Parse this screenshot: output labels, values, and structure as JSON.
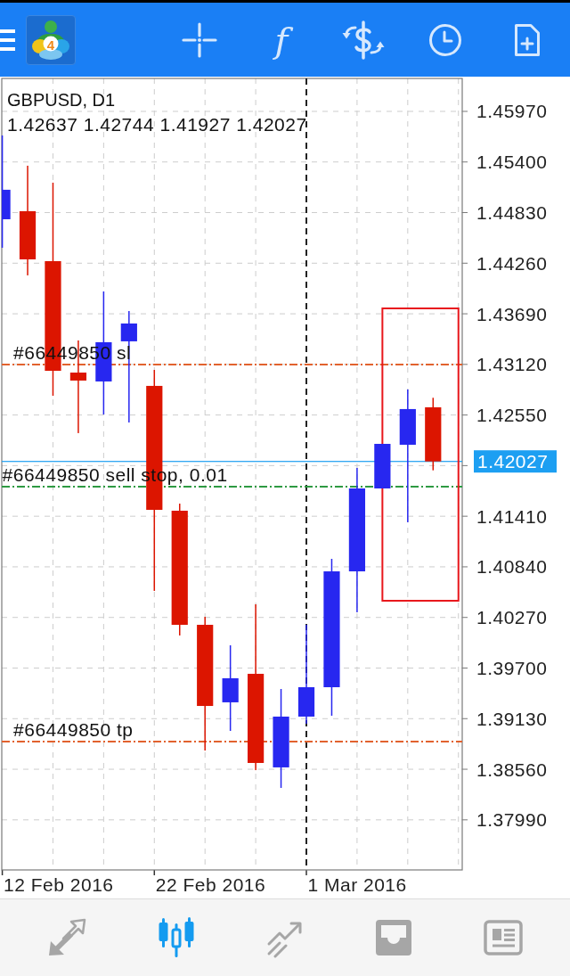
{
  "toolbar": {
    "logo": {
      "text": "4"
    },
    "items": [
      {
        "kind": "crosshair"
      },
      {
        "kind": "function",
        "text": "f"
      },
      {
        "kind": "exchange"
      },
      {
        "kind": "clock"
      },
      {
        "kind": "new_document"
      }
    ]
  },
  "chart": {
    "title": "GBPUSD, D1",
    "ohlc": "1.42637 1.42744 1.41927 1.42027",
    "order_lines": [
      {
        "label": "#66449850 sl",
        "color": "#e2622e"
      },
      {
        "label": "#66449850 sell stop, 0.01",
        "color": "#2e9a42"
      },
      {
        "label": "#66449850 tp",
        "color": "#e2622e"
      }
    ],
    "price_axis": [
      "1.45970",
      "1.45400",
      "1.44830",
      "1.44260",
      "1.43690",
      "1.43120",
      "1.42550",
      "1.41410",
      "1.40840",
      "1.40270",
      "1.39700",
      "1.39130",
      "1.38560",
      "1.37990"
    ],
    "price_tag": "1.42027",
    "date_axis": [
      "12 Feb 2016",
      "22 Feb 2016",
      "1 Mar 2016"
    ]
  },
  "bottom_nav": [
    {
      "kind": "quotes",
      "selected": false
    },
    {
      "kind": "chart",
      "selected": true
    },
    {
      "kind": "trade",
      "selected": false
    },
    {
      "kind": "history",
      "selected": false
    },
    {
      "kind": "news",
      "selected": false
    }
  ]
}
